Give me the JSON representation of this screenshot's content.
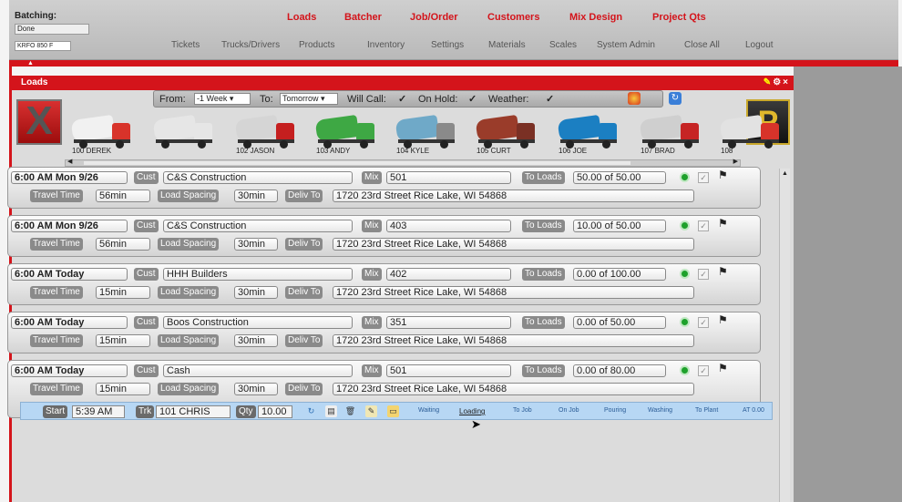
{
  "header": {
    "batching_label": "Batching:",
    "batching_value": "Done",
    "batch_id": "KRFO 850 F",
    "main_menu": [
      "Loads",
      "Batcher",
      "Job/Order",
      "Customers",
      "Mix Design",
      "Project Qts"
    ],
    "sub_menu": [
      "Tickets",
      "Trucks/Drivers",
      "Products",
      "Inventory",
      "Settings",
      "Materials",
      "Scales",
      "System Admin",
      "Close All",
      "Logout"
    ]
  },
  "panel": {
    "title": "Loads",
    "filter": {
      "from_label": "From:",
      "from_value": "-1 Week",
      "to_label": "To:",
      "to_value": "Tomorrow",
      "will_call_label": "Will Call:",
      "on_hold_label": "On Hold:",
      "weather_label": "Weather:",
      "check": "✓"
    }
  },
  "trucks": [
    {
      "label": "100 DEREK",
      "body": "#f1f1f1",
      "cab": "#d8332a"
    },
    {
      "label": "",
      "body": "#e6e6e6",
      "cab": "#e6e6e6"
    },
    {
      "label": "102 JASON",
      "body": "#d5d5d5",
      "cab": "#c51f1f"
    },
    {
      "label": "103 ANDY",
      "body": "#3ea844",
      "cab": "#3ea844"
    },
    {
      "label": "104 KYLE",
      "body": "#6fa9c8",
      "cab": "#8a8a8a"
    },
    {
      "label": "105 CURT",
      "body": "#9a3c2a",
      "cab": "#7a3024"
    },
    {
      "label": "106 JOE",
      "body": "#1b7fc2",
      "cab": "#1b7fc2"
    },
    {
      "label": "107 BRAD",
      "body": "#cfcfcf",
      "cab": "#c62424"
    },
    {
      "label": "108",
      "body": "#e2e2e2",
      "cab": "#d8332a"
    }
  ],
  "labels": {
    "cust": "Cust",
    "mix": "Mix",
    "to_loads": "To Loads",
    "travel_time": "Travel Time",
    "load_spacing": "Load Spacing",
    "deliv_to": "Deliv To"
  },
  "loads": [
    {
      "time": "6:00 AM Mon 9/26",
      "customer": "C&S Construction",
      "mix": "501",
      "to_loads": "50.00 of 50.00",
      "travel": "56min",
      "spacing": "30min",
      "address": "1720 23rd Street Rice Lake, WI 54868"
    },
    {
      "time": "6:00 AM Mon 9/26",
      "customer": "C&S Construction",
      "mix": "403",
      "to_loads": "10.00 of 50.00",
      "travel": "56min",
      "spacing": "30min",
      "address": "1720 23rd Street Rice Lake, WI 54868"
    },
    {
      "time": "6:00 AM Today",
      "customer": "HHH Builders",
      "mix": "402",
      "to_loads": "0.00 of 100.00",
      "travel": "15min",
      "spacing": "30min",
      "address": "1720 23rd Street Rice Lake, WI 54868"
    },
    {
      "time": "6:00 AM Today",
      "customer": "Boos Construction",
      "mix": "351",
      "to_loads": "0.00 of 50.00",
      "travel": "15min",
      "spacing": "30min",
      "address": "1720 23rd Street Rice Lake, WI 54868"
    },
    {
      "time": "6:00 AM Today",
      "customer": "Cash",
      "mix": "501",
      "to_loads": "0.00 of 80.00",
      "travel": "15min",
      "spacing": "30min",
      "address": "1720 23rd Street Rice Lake, WI 54868"
    }
  ],
  "ticket": {
    "start_label": "Start",
    "start_value": "5:39 AM",
    "truck_label": "Trk",
    "truck_value": "101 CHRIS",
    "qty_label": "Qty",
    "qty_value": "10.00",
    "stages": [
      "Waiting",
      "Loading",
      "To Job",
      "On Job",
      "Pouring",
      "Washing",
      "To Plant",
      "AT 0.00"
    ]
  }
}
